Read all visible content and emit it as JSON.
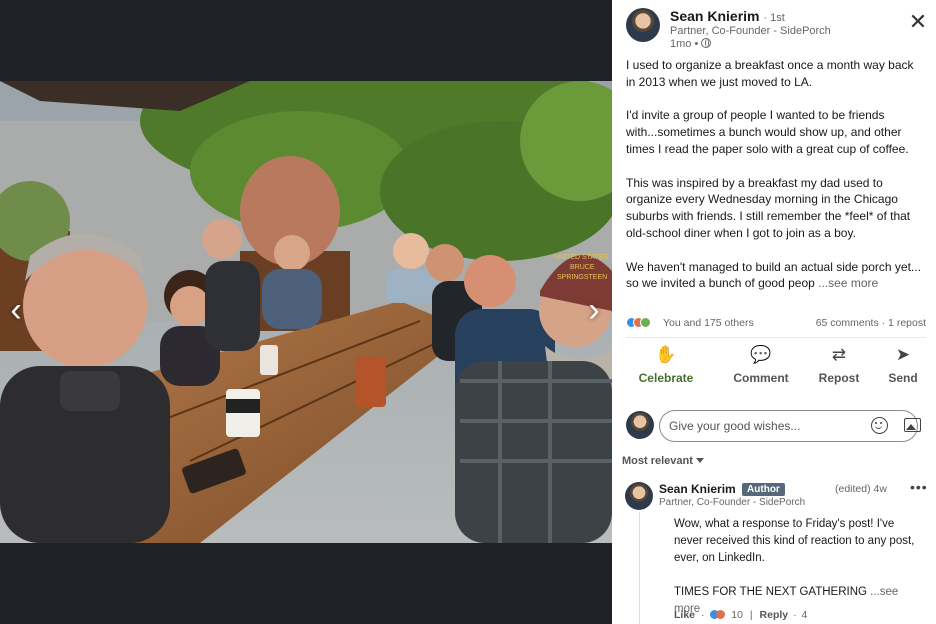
{
  "post": {
    "author_name": "Sean Knierim",
    "degree": "· 1st",
    "author_title": "Partner, Co-Founder - SidePorch",
    "time": "1mo •",
    "paragraphs": [
      "I used to organize a breakfast once a month way back in 2013 when we just moved to LA.",
      "I'd invite a group of people I wanted to be friends with...sometimes a bunch would show up, and other times I read the paper solo with a great cup of coffee.",
      "This was inspired by a breakfast my dad used to organize every Wednesday morning in the Chicago suburbs with friends. I still remember the *feel* of that old-school diner when I got to join as a boy.",
      "We haven't managed to build an actual side porch yet... so we invited a bunch of good peop"
    ],
    "see_more": "...see more"
  },
  "social": {
    "reactions_text": "You and 175 others",
    "comments_text": "65 comments · 1 repost"
  },
  "actions": {
    "celebrate": "Celebrate",
    "comment": "Comment",
    "repost": "Repost",
    "send": "Send"
  },
  "compose": {
    "placeholder": "Give your good wishes..."
  },
  "sort": {
    "label": "Most relevant"
  },
  "comment": {
    "name": "Sean Knierim",
    "badge": "Author",
    "meta": "(edited) 4w",
    "more": "•••",
    "title": "Partner, Co-Founder - SidePorch",
    "lines": [
      "Wow, what a response to Friday's post! I've never received this kind of reaction to any post, ever, on LinkedIn.",
      "TIMES FOR THE NEXT GATHERING"
    ],
    "see_more": "...see more",
    "like": "Like",
    "like_count": "10",
    "reply": "Reply",
    "reply_count": "4"
  },
  "viewer": {
    "prev_icon": "chevron-left-icon",
    "next_icon": "chevron-right-icon",
    "prev": "‹",
    "next": "›",
    "close": "✕"
  },
  "hat_text": [
    "UNITED STATES",
    "BRUCE",
    "SPRINGSTEEN"
  ]
}
